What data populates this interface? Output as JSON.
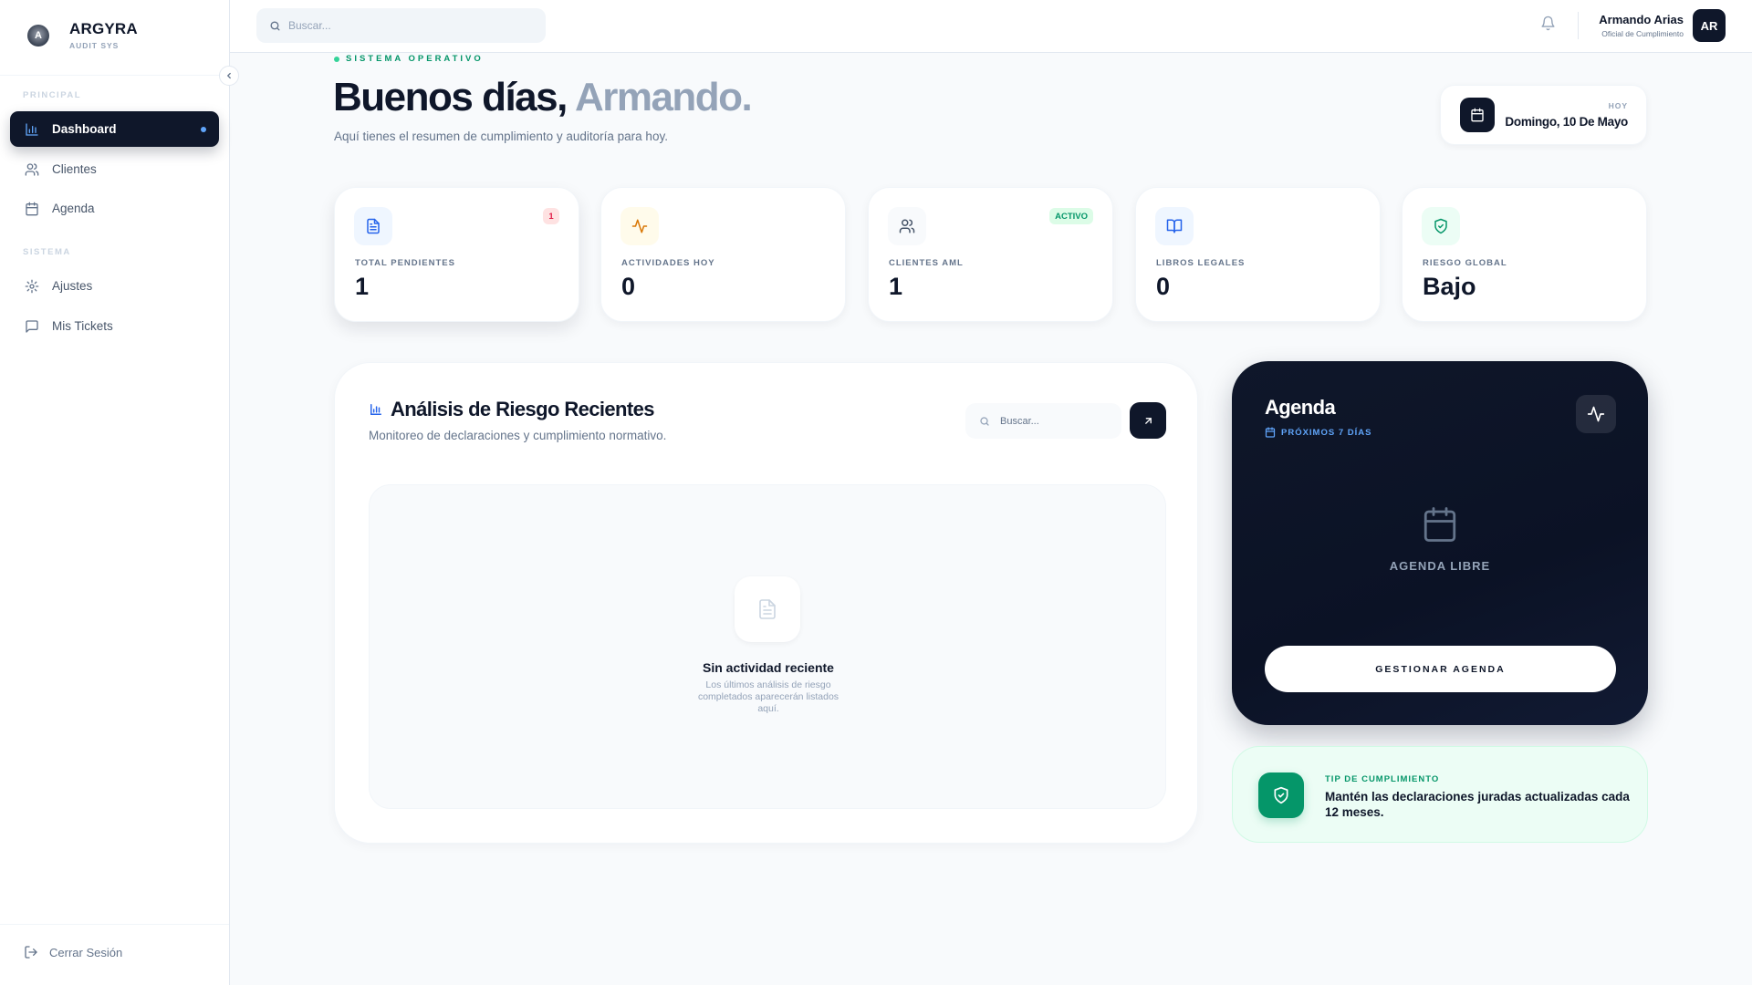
{
  "sidebar": {
    "brand_logo_text": "A",
    "brand_name": "ARGYRA",
    "brand_sub": "AUDIT SYS",
    "section_principal": "PRINCIPAL",
    "section_sistema": "SISTEMA",
    "items": [
      {
        "label": "Dashboard",
        "icon": "bar-chart-icon",
        "active": true
      },
      {
        "label": "Clientes",
        "icon": "users-icon"
      },
      {
        "label": "Agenda",
        "icon": "calendar-icon"
      },
      {
        "label": "Ajustes",
        "icon": "gear-icon"
      },
      {
        "label": "Mis Tickets",
        "icon": "message-square-icon"
      }
    ],
    "logout_label": "Cerrar Sesión"
  },
  "topbar": {
    "search_placeholder": "Buscar...",
    "user_name": "Armando Arias",
    "user_role": "Oficial de Cumplimiento",
    "avatar_initials": "AR"
  },
  "header": {
    "status": "SISTEMA OPERATIVO",
    "greeting": "Buenos días,",
    "greeting_name": "Armando.",
    "subtitle": "Aquí tienes el resumen de cumplimiento y auditoría para hoy.",
    "date_label": "HOY",
    "date_value": "Domingo, 10 De Mayo"
  },
  "stats": [
    {
      "label": "TOTAL PENDIENTES",
      "value": "1",
      "badge": "1",
      "icon": "file-text-icon",
      "color": "#2563eb"
    },
    {
      "label": "ACTIVIDADES HOY",
      "value": "0",
      "icon": "activity-icon",
      "color": "#d97706"
    },
    {
      "label": "CLIENTES AML",
      "value": "1",
      "badge": "ACTIVO",
      "icon": "users-icon",
      "color": "#475569"
    },
    {
      "label": "LIBROS LEGALES",
      "value": "0",
      "icon": "book-open-icon",
      "color": "#2563eb"
    },
    {
      "label": "RIESGO GLOBAL",
      "value": "Bajo",
      "icon": "shield-check-icon",
      "color": "#059669"
    }
  ],
  "analysis": {
    "title": "Análisis de Riesgo Recientes",
    "subtitle": "Monitoreo de declaraciones y cumplimiento normativo.",
    "search_placeholder": "Buscar...",
    "empty_title": "Sin actividad reciente",
    "empty_text": "Los últimos análisis de riesgo completados aparecerán listados aquí."
  },
  "agenda": {
    "title": "Agenda",
    "subtitle": "PRÓXIMOS 7 DÍAS",
    "empty": "AGENDA LIBRE",
    "button": "GESTIONAR AGENDA"
  },
  "tip": {
    "label": "TIP DE CUMPLIMIENTO",
    "text": "Mantén las declaraciones juradas actualizadas cada 12 meses."
  },
  "colors": {
    "primary": "#0f172a",
    "accent_blue": "#60a5fa",
    "success": "#059669",
    "danger": "#e11d48",
    "background": "#f8fafc"
  }
}
